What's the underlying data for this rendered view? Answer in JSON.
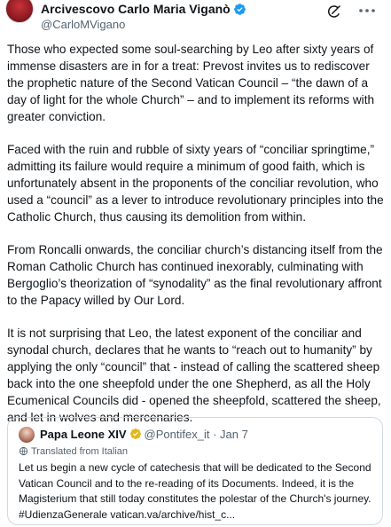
{
  "author": {
    "name": "Arcivescovo Carlo Maria Viganò",
    "handle": "@CarloMVigano"
  },
  "post": {
    "paragraphs": [
      "Those who expected some soul-searching by Leo after sixty years of immense disasters are in for a treat: Prevost invites us to rediscover the prophetic nature of the Second Vatican Council – “the dawn of a day of light for the whole Church” – and to implement its reforms with greater conviction.",
      "Faced with the ruin and rubble of sixty years of “conciliar springtime,” admitting its failure would require a minimum of good faith, which is unfortunately absent in the proponents of the conciliar revolution, who used a “council” as a lever to introduce revolutionary principles into the Catholic Church, thus causing its demolition from within.",
      "From Roncalli onwards, the conciliar church’s distancing itself from the Roman Catholic Church has continued inexorably, culminating with Bergoglio’s theorization of “synodality” as the final revolutionary affront to the Papacy willed by Our Lord.",
      "It is not surprising that Leo, the latest exponent of the conciliar and synodal church, declares that he wants to “reach out to humanity” by applying the only “council” that - instead of calling the scattered sheep back into the one sheepfold under the one Shepherd, as all the Holy Ecumenical Councils did - opened the sheepfold, scattered the sheep, and let in wolves and mercenaries."
    ]
  },
  "quote": {
    "name": "Papa Leone XIV",
    "handle": "@Pontifex_it",
    "separator": "·",
    "date": "Jan 7",
    "translated_label": "Translated from Italian",
    "text": "Let us begin a new cycle of catechesis that will be dedicated to the Second Vatican Council and to the re-reading of its Documents. Indeed, it is the Magisterium that still today constitutes the polestar of the Church's journey. #UdienzaGenerale vatican.va/archive/hist_c..."
  },
  "icons": {
    "verified": "verified-badge-icon",
    "grok": "grok-icon",
    "more": "more-options-icon",
    "translate": "translate-icon",
    "gold_badge": "gold-verified-badge-icon"
  },
  "colors": {
    "text": "#0f1419",
    "secondary": "#536471",
    "verified_blue": "#1d9bf0",
    "gold": "#e2b719",
    "border": "#cfd9de"
  }
}
